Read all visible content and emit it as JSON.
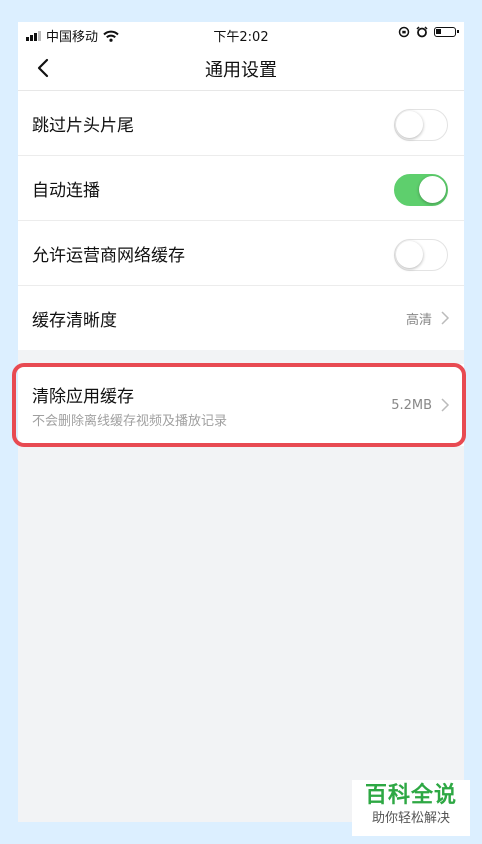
{
  "status_bar": {
    "carrier": "中国移动",
    "time": "下午2:02"
  },
  "header": {
    "title": "通用设置"
  },
  "settings": [
    {
      "label": "跳过片头片尾",
      "type": "toggle",
      "on": false
    },
    {
      "label": "自动连播",
      "type": "toggle",
      "on": true
    },
    {
      "label": "允许运营商网络缓存",
      "type": "toggle",
      "on": false
    },
    {
      "label": "缓存清晰度",
      "type": "value",
      "value": "高清"
    }
  ],
  "cache": {
    "label": "清除应用缓存",
    "description": "不会删除离线缓存视频及播放记录",
    "value": "5.2MB"
  },
  "watermark": {
    "title": "百科全说",
    "subtitle": "助你轻松解决"
  },
  "colors": {
    "toggle_on": "#5ecf6d",
    "highlight_border": "#e84a52",
    "watermark_green": "#2ea844"
  }
}
